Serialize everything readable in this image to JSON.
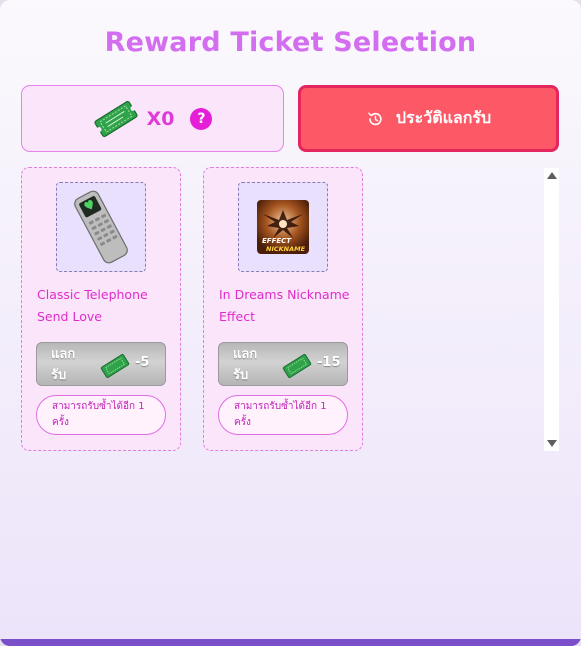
{
  "title": "Reward Ticket Selection",
  "ticket_balance": {
    "icon": "ticket-icon",
    "count": "X0",
    "help": "?"
  },
  "history_button": {
    "icon": "history-icon",
    "label": "ประวัติแลกรับ"
  },
  "rewards": [
    {
      "name": "Classic Telephone Send Love",
      "icon": "telephone-icon",
      "redeem_label": "แลกรับ",
      "cost": "-5",
      "limit": "สามารถรับซ้ำได้อีก 1 ครั้ง"
    },
    {
      "name": "In Dreams Nickname Effect",
      "icon": "nickname-effect-icon",
      "image_text": "EFFECT NICKNAME",
      "redeem_label": "แลกรับ",
      "cost": "-15",
      "limit": "สามารถรับซ้ำได้อีก 1 ครั้ง"
    }
  ],
  "colors": {
    "title": "#d36ef0",
    "history_button": "#fd5865",
    "card_background": "#fbe5fb",
    "accent_magenta": "#e51fd8",
    "ticket_green": "#2fa24a"
  }
}
